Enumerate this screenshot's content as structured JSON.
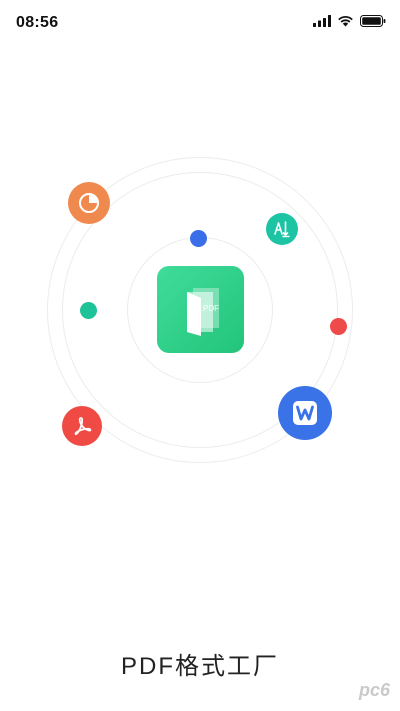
{
  "status_bar": {
    "time": "08:56"
  },
  "app": {
    "name": "PDF格式工厂",
    "logo_text": "PDF"
  },
  "watermark": {
    "text": "pc6"
  },
  "colors": {
    "chart_badge": "#f0894d",
    "convert_badge": "#1cc4a3",
    "word_badge": "#3a72e8",
    "acrobat_badge": "#ef4a44",
    "blue_dot": "#3a6ee8",
    "teal_dot": "#1ec39a",
    "red_dot": "#ef4a4a",
    "logo_green": "#2fd08a"
  },
  "icons": [
    "pie-chart-icon",
    "text-convert-icon",
    "word-icon",
    "acrobat-icon"
  ]
}
